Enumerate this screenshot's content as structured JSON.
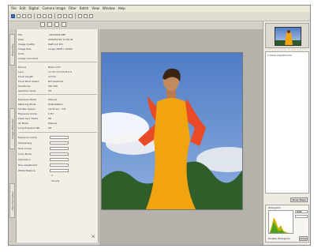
{
  "menu": [
    "File",
    "Edit",
    "Digital",
    "Camera Image",
    "Filter",
    "Batch",
    "View",
    "Window",
    "Help"
  ],
  "left_tabs": [
    "Properties",
    "Image Attributes",
    "File Information"
  ],
  "properties": [
    {
      "label": "File",
      "value": "_DSC0016.NEF"
    },
    {
      "label": "Date",
      "value": "2004/07/29 11:09:41"
    },
    {
      "label": "Image Quality",
      "value": "RAW (12 bit)"
    },
    {
      "label": "Image Size",
      "value": "Large (3008 x 2000)"
    },
    {
      "label": "Color",
      "value": ""
    },
    {
      "label": "Image Comment",
      "value": ""
    },
    {
      "label": "Device",
      "value": "Nikon D70"
    },
    {
      "label": "Lens",
      "value": "17-70 mm F/2.8-4.5"
    },
    {
      "label": "Focal Length",
      "value": "17mm"
    },
    {
      "label": "Focal Point Select",
      "value": "Not Selected"
    },
    {
      "label": "Sensitivity",
      "value": "ISO 200"
    },
    {
      "label": "Aperture Value",
      "value": "f/8"
    },
    {
      "label": "Exposure Mode",
      "value": "Manual"
    },
    {
      "label": "Metering Mode",
      "value": "Multi-Pattern"
    },
    {
      "label": "Shutter Speed",
      "value": "1/125 sec - F/8"
    },
    {
      "label": "Exposure Comp.",
      "value": "0 EV"
    },
    {
      "label": "Flash Sync Mode",
      "value": "Off"
    },
    {
      "label": "AF Mode",
      "value": "Manual"
    },
    {
      "label": "Long Exposure NR",
      "value": "Off"
    }
  ],
  "settings": [
    {
      "label": "Exposure Comp.",
      "value": "0 EV"
    },
    {
      "label": "Sharpening",
      "value": "Normal"
    },
    {
      "label": "Tone Comp.",
      "value": "Normal"
    },
    {
      "label": "Color Mode",
      "value": "Mode I"
    },
    {
      "label": "Saturation",
      "value": "Normal"
    },
    {
      "label": "Hue Adjustment",
      "value": "0"
    },
    {
      "label": "White Balance",
      "value": "Cloudy"
    }
  ],
  "right": {
    "list_header": "5 Show Adjustments",
    "show_button": "Show Steps",
    "histogram_title": "Histogram",
    "histogram_channel": "RGB",
    "histogram_footer": "Disable Histogram",
    "histogram_button": "Close"
  },
  "colors": {
    "window": "#d4d0c8",
    "sky": "#4f7cc6",
    "dress": "#f2a310"
  }
}
